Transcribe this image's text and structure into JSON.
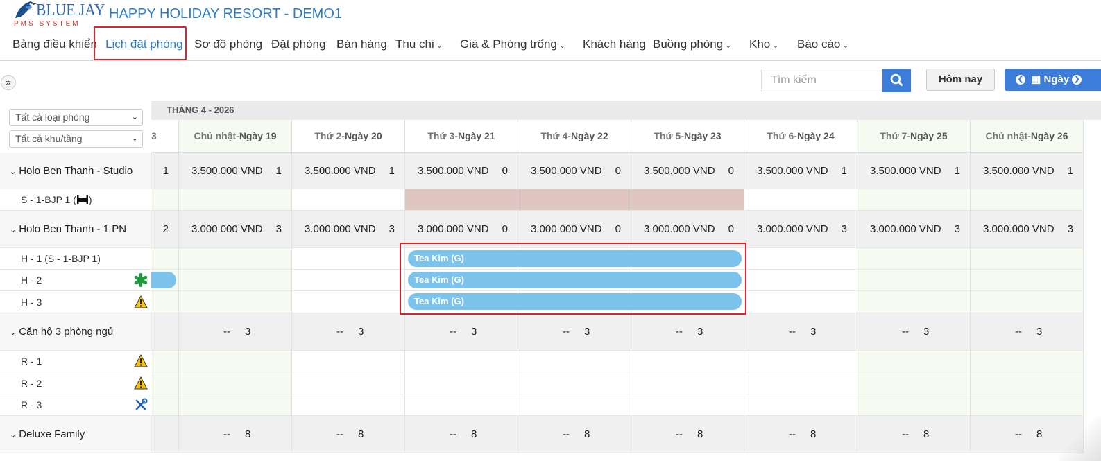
{
  "brand": {
    "logo_word": "BLUE JAY",
    "logo_sub": "PMS SYSTEM",
    "resort_title": "HAPPY HOLIDAY RESORT - DEMO1"
  },
  "nav": [
    {
      "label": "Bảng điều khiển",
      "dropdown": false
    },
    {
      "label": "Lịch đặt phòng",
      "dropdown": false,
      "active": true
    },
    {
      "label": "Sơ đồ phòng",
      "dropdown": false
    },
    {
      "label": "Đặt phòng",
      "dropdown": false
    },
    {
      "label": "Bán hàng",
      "dropdown": false
    },
    {
      "label": "Thu chi",
      "dropdown": true
    },
    {
      "label": "Giá & Phòng trống",
      "dropdown": true
    },
    {
      "label": "Khách hàng",
      "dropdown": false
    },
    {
      "label": "Buồng phòng",
      "dropdown": true
    },
    {
      "label": "Kho",
      "dropdown": true
    },
    {
      "label": "Báo cáo",
      "dropdown": true
    }
  ],
  "toolbar": {
    "toggle_glyph": "»",
    "search_placeholder": "Tìm kiếm",
    "today_label": "Hôm nay",
    "day_label": "Ngày"
  },
  "filters": {
    "room_type": "Tất cả loại phòng",
    "area": "Tất cả khu/tầng"
  },
  "calendar": {
    "month_label": "THÁNG 4 - 2026",
    "partial_col_label": "3",
    "days": [
      {
        "dow": "Chủ nhật-",
        "day": "Ngày 19",
        "weekend": true
      },
      {
        "dow": "Thứ 2-",
        "day": "Ngày 20",
        "weekend": false
      },
      {
        "dow": "Thứ 3-",
        "day": "Ngày 21",
        "weekend": false
      },
      {
        "dow": "Thứ 4-",
        "day": "Ngày 22",
        "weekend": false
      },
      {
        "dow": "Thứ 5-",
        "day": "Ngày 23",
        "weekend": false
      },
      {
        "dow": "Thứ 6-",
        "day": "Ngày 24",
        "weekend": false
      },
      {
        "dow": "Thứ 7-",
        "day": "Ngày 25",
        "weekend": true
      },
      {
        "dow": "Chủ nhật-",
        "day": "Ngày 26",
        "weekend": true
      }
    ],
    "groups": [
      {
        "name": "Holo Ben Thanh - Studio",
        "partial_avail": "1",
        "prices": [
          "3.500.000 VND",
          "3.500.000 VND",
          "3.500.000 VND",
          "3.500.000 VND",
          "3.500.000 VND",
          "3.500.000 VND",
          "3.500.000 VND",
          "3.500.000 VND"
        ],
        "avail": [
          "1",
          "1",
          "0",
          "0",
          "0",
          "1",
          "1",
          "1"
        ],
        "rooms": [
          {
            "name": "S - 1-BJP 1 (",
            "suffix": ")",
            "icon": "bed-icon"
          }
        ]
      },
      {
        "name": "Holo Ben Thanh - 1 PN",
        "partial_avail": "2",
        "prices": [
          "3.000.000 VND",
          "3.000.000 VND",
          "3.000.000 VND",
          "3.000.000 VND",
          "3.000.000 VND",
          "3.000.000 VND",
          "3.000.000 VND",
          "3.000.000 VND"
        ],
        "avail": [
          "3",
          "3",
          "0",
          "0",
          "0",
          "3",
          "3",
          "3"
        ],
        "rooms": [
          {
            "name": "H - 1 (S - 1-BJP 1)",
            "icon": ""
          },
          {
            "name": "H - 2",
            "icon": "asterisk-icon"
          },
          {
            "name": "H - 3",
            "icon": "warning-icon"
          }
        ]
      },
      {
        "name": "Căn hộ 3 phòng ngủ",
        "dash": "--",
        "count": "3",
        "rooms": [
          {
            "name": "R - 1",
            "icon": "warning-icon"
          },
          {
            "name": "R - 2",
            "icon": "warning-icon"
          },
          {
            "name": "R - 3",
            "icon": "tools-icon"
          }
        ]
      },
      {
        "name": "Deluxe Family",
        "dash": "--",
        "count": "8",
        "rooms": []
      }
    ],
    "bookings": [
      {
        "room": "H - 1 (S - 1-BJP 1)",
        "guest": "Tea Kim (G)"
      },
      {
        "room": "H - 2",
        "guest": "Tea Kim (G)"
      },
      {
        "room": "H - 3",
        "guest": "Tea Kim (G)"
      }
    ]
  },
  "colors": {
    "brand_blue": "#2f7ec4",
    "primary_button": "#3b7dd8",
    "booking_bar": "#7cc4ec",
    "blocked_cell": "#dfc6c0",
    "highlight": "#e0202a"
  }
}
